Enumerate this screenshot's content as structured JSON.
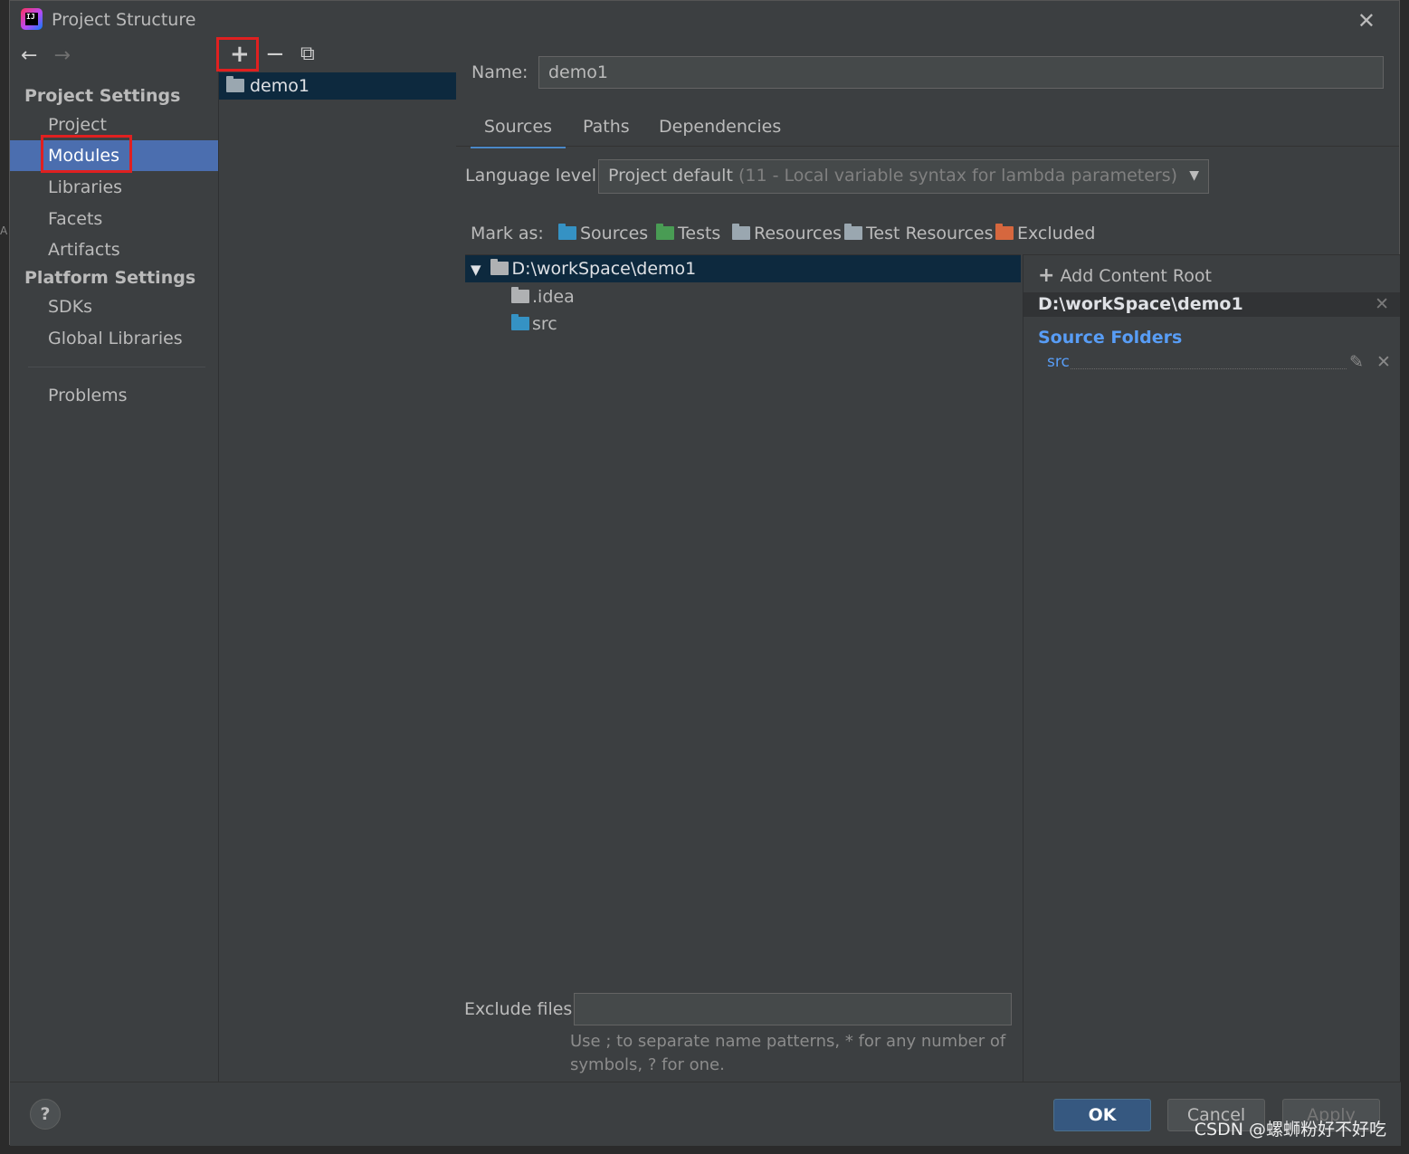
{
  "window": {
    "title": "Project Structure",
    "close_glyph": "✕"
  },
  "nav": {
    "back": "←",
    "forward": "→",
    "project_settings": "Project Settings",
    "platform_settings": "Platform Settings",
    "items": [
      "Project",
      "Modules",
      "Libraries",
      "Facets",
      "Artifacts"
    ],
    "platform_items": [
      "SDKs",
      "Global Libraries"
    ],
    "problems": "Problems",
    "selected": "Modules"
  },
  "module_toolbar": {
    "add": "+",
    "remove": "−",
    "copy": "⧉"
  },
  "modules": [
    "demo1"
  ],
  "main": {
    "name_label": "Name:",
    "name_value": "demo1",
    "tabs": [
      "Sources",
      "Paths",
      "Dependencies"
    ],
    "active_tab": "Sources",
    "language_label": "Language level:",
    "language_value": "Project default",
    "language_detail": "(11 - Local variable syntax for lambda parameters)",
    "mark_as_label": "Mark as:",
    "mark_as": [
      "Sources",
      "Tests",
      "Resources",
      "Test Resources",
      "Excluded"
    ],
    "tree": {
      "root": "D:\\workSpace\\demo1",
      "children": [
        ".idea",
        "src"
      ]
    },
    "exclude_label": "Exclude files:",
    "exclude_value": "",
    "hint_line1": "Use ; to separate name patterns, * for any number of",
    "hint_line2": "symbols, ? for one."
  },
  "content_root": {
    "add": "Add Content Root",
    "path": "D:\\workSpace\\demo1",
    "source_folders_label": "Source Folders",
    "source_folders": [
      "src"
    ]
  },
  "footer": {
    "help": "?",
    "ok": "OK",
    "cancel": "Cancel",
    "apply": "Apply",
    "watermark": "CSDN @螺蛳粉好不好吃"
  },
  "colors": {
    "dialog_bg": "#3c3f41",
    "selection": "#4b6eaf",
    "tree_selection": "#0d293e",
    "highlight_box": "#e02020",
    "link_blue": "#589df6"
  }
}
